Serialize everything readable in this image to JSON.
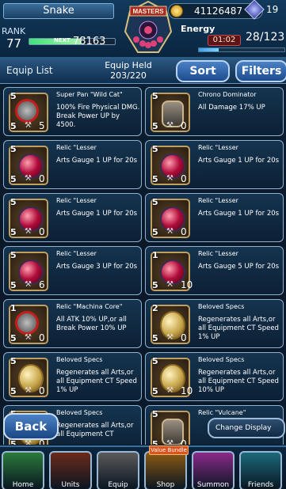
{
  "header": {
    "player_name": "Snake",
    "rank_label": "RANK",
    "rank": "77",
    "next_label": "NEXT",
    "next_exp": "78163",
    "exp_progress": 0.6,
    "gil": "41126487",
    "gems_partial": "19",
    "energy_label": "Energy",
    "energy_timer": "01:02",
    "energy_value": "28/123",
    "energy_progress": 0.23
  },
  "subbar": {
    "title": "Equip List",
    "held_label": "Equip Held",
    "held_value": "203/220",
    "sort_label": "Sort",
    "filters_label": "Filters"
  },
  "cards": [
    {
      "rarity": "5",
      "level": "5",
      "count": "5",
      "icon": "pan",
      "title": "Super Pan \"Wild Cat\"",
      "desc": "100% Fire Physical DMG. Break Power UP by 4500."
    },
    {
      "rarity": "5",
      "level": "5",
      "count": "0",
      "icon": "lock",
      "title": "Chrono Dominator",
      "desc": "All Damage 17% UP"
    },
    {
      "rarity": "5",
      "level": "5",
      "count": "0",
      "icon": "red",
      "title": "Relic \"Lesser",
      "desc": "Arts Gauge 1 UP for 20s"
    },
    {
      "rarity": "5",
      "level": "5",
      "count": "0",
      "icon": "red",
      "title": "Relic \"Lesser",
      "desc": "Arts Gauge 1 UP for 20s"
    },
    {
      "rarity": "5",
      "level": "5",
      "count": "0",
      "icon": "red",
      "title": "Relic \"Lesser",
      "desc": "Arts Gauge 1 UP for 20s"
    },
    {
      "rarity": "5",
      "level": "5",
      "count": "0",
      "icon": "red",
      "title": "Relic \"Lesser",
      "desc": "Arts Gauge 1 UP for 20s"
    },
    {
      "rarity": "5",
      "level": "5",
      "count": "6",
      "icon": "red",
      "title": "Relic \"Lesser",
      "desc": "Arts Gauge 3 UP for 20s"
    },
    {
      "rarity": "1",
      "level": "5",
      "count": "10",
      "icon": "red",
      "title": "Relic \"Lesser",
      "desc": "Arts Gauge 5 UP for 20s"
    },
    {
      "rarity": "1",
      "level": "5",
      "count": "0",
      "icon": "pan",
      "title": "Relic \"Machina Core\"",
      "desc": "All ATK 10% UP,or all Break Power 10% UP"
    },
    {
      "rarity": "2",
      "level": "5",
      "count": "0",
      "icon": "gold",
      "title": "Beloved Specs",
      "desc": "Regenerates all Arts,or all Equipment CT Speed 1% UP"
    },
    {
      "rarity": "5",
      "level": "5",
      "count": "0",
      "icon": "gold",
      "title": "Beloved Specs",
      "desc": "Regenerates all Arts,or all Equipment CT Speed 1% UP"
    },
    {
      "rarity": "5",
      "level": "5",
      "count": "10",
      "icon": "gold",
      "title": "Beloved Specs",
      "desc": "Regenerates all Arts,or all Equipment CT Speed 10% UP"
    },
    {
      "rarity": "5",
      "level": "5",
      "count": "0",
      "icon": "gold",
      "title": "Beloved Specs",
      "desc": "Regenerates all Arts,or all Equipment CT"
    },
    {
      "rarity": "5",
      "level": "5",
      "count": "0",
      "icon": "lock",
      "title": "Relic \"Vulcane\"",
      "desc": ""
    }
  ],
  "bottom": {
    "back_label": "Back",
    "change_display_label": "Change Display",
    "value_bundle_label": "Value Bundle",
    "nav": [
      {
        "label": "Home",
        "color": "#2a7a3a"
      },
      {
        "label": "Units",
        "color": "#6a2a1a"
      },
      {
        "label": "Equip",
        "color": "#5a5a5a"
      },
      {
        "label": "Shop",
        "color": "#8a5a12"
      },
      {
        "label": "Summon",
        "color": "#8a2a8a"
      },
      {
        "label": "Friends",
        "color": "#1a6a7a"
      }
    ]
  },
  "colors": {
    "accent": "#4b82c5",
    "border": "#8fb1cf"
  }
}
